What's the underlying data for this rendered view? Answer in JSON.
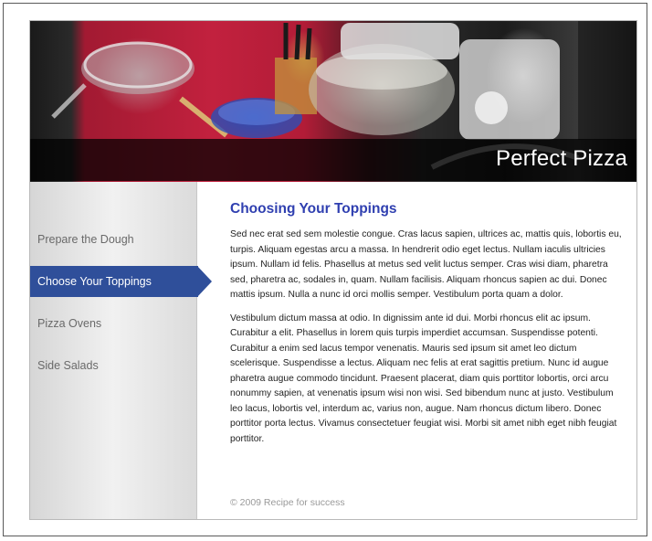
{
  "header": {
    "site_title": "Perfect Pizza"
  },
  "sidebar": {
    "items": [
      {
        "label": "Prepare the Dough",
        "active": false
      },
      {
        "label": "Choose Your Toppings",
        "active": true
      },
      {
        "label": "Pizza Ovens",
        "active": false
      },
      {
        "label": "Side Salads",
        "active": false
      }
    ]
  },
  "main": {
    "heading": "Choosing Your Toppings",
    "paragraphs": [
      "Sed nec erat sed sem molestie congue. Cras lacus sapien, ultrices ac, mattis quis, lobortis eu, turpis. Aliquam egestas arcu a massa. In hendrerit odio eget lectus. Nullam iaculis ultricies ipsum. Nullam id felis. Phasellus at metus sed velit luctus semper. Cras wisi diam, pharetra sed, pharetra ac, sodales in, quam. Nullam facilisis. Aliquam rhoncus sapien ac dui. Donec mattis ipsum. Nulla a nunc id orci mollis semper. Vestibulum porta quam a dolor.",
      "Vestibulum dictum massa at odio. In dignissim ante id dui. Morbi rhoncus elit ac ipsum. Curabitur a elit. Phasellus in lorem quis turpis imperdiet accumsan. Suspendisse potenti. Curabitur a enim sed lacus tempor venenatis. Mauris sed ipsum sit amet leo dictum scelerisque. Suspendisse a lectus. Aliquam nec felis at erat sagittis pretium. Nunc id augue pharetra augue commodo tincidunt. Praesent placerat, diam quis porttitor lobortis, orci arcu nonummy sapien, at venenatis ipsum wisi non wisi. Sed bibendum nunc at justo. Vestibulum leo lacus, lobortis vel, interdum ac, varius non, augue. Nam rhoncus dictum libero. Donec porttitor porta lectus. Vivamus consectetuer feugiat wisi. Morbi sit amet nibh eget nibh feugiat porttitor."
    ]
  },
  "footer": {
    "copyright": "© 2009 Recipe for success"
  },
  "colors": {
    "accent": "#2f4f9a",
    "heading": "#2f3fb0",
    "banner_red": "#c2213e"
  }
}
